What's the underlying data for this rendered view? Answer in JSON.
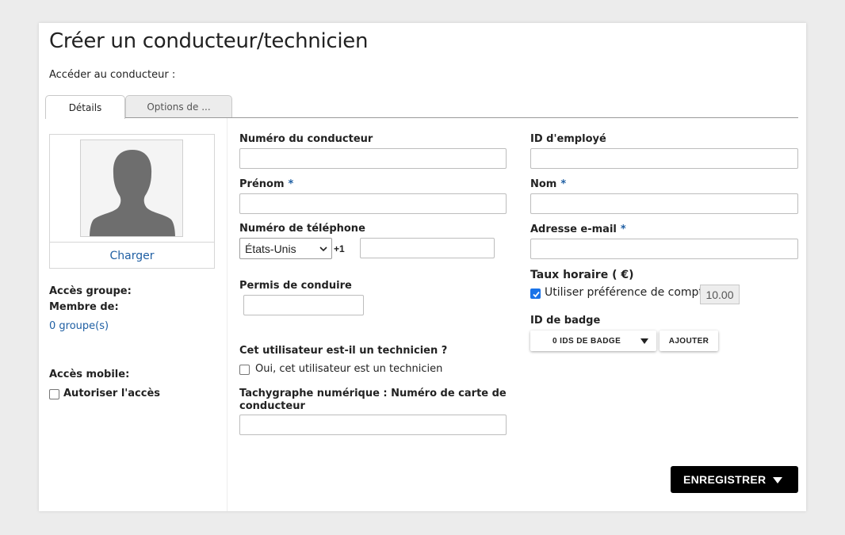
{
  "page": {
    "title": "Créer un conducteur/technicien",
    "access_label": "Accéder au conducteur :"
  },
  "tabs": [
    {
      "label": "Détails",
      "active": true
    },
    {
      "label": "Options de ...",
      "active": false
    }
  ],
  "photo": {
    "upload_label": "Charger",
    "avatar_icon": "person-silhouette-icon"
  },
  "sidebar": {
    "group_access_label": "Accès groupe:",
    "member_of_label": "Membre de:",
    "groups_link": "0 groupe(s)",
    "mobile_access_label": "Accès mobile:",
    "allow_access_label": "Autoriser l'accès",
    "allow_access_checked": false
  },
  "form": {
    "driver_number": {
      "label": "Numéro du conducteur",
      "value": "",
      "placeholder": ""
    },
    "employee_id": {
      "label": "ID d'employé",
      "value": "",
      "placeholder": ""
    },
    "first_name": {
      "label": "Prénom",
      "required_mark": "*",
      "value": "",
      "placeholder": ""
    },
    "last_name": {
      "label": "Nom",
      "required_mark": "*",
      "value": "",
      "placeholder": ""
    },
    "phone": {
      "label": "Numéro de téléphone",
      "country": "États-Unis",
      "dial_code": "+1",
      "value": "",
      "placeholder": ""
    },
    "email": {
      "label": "Adresse e-mail",
      "required_mark": "*",
      "value": "",
      "placeholder": ""
    },
    "license": {
      "label": "Permis de conduire",
      "value": "",
      "placeholder": ""
    },
    "hourly_rate": {
      "label": "Taux horaire ( €)",
      "use_account_pref_label": "Utiliser préférence de compte",
      "use_account_pref_checked": true,
      "value": "10.00"
    },
    "badge": {
      "label": "ID de badge",
      "dropdown_label": "0 IDS DE BADGE",
      "add_label": "AJOUTER"
    },
    "technician": {
      "question": "Cet utilisateur est-il un technicien ?",
      "checkbox_label": "Oui, cet utilisateur est un technicien",
      "checked": false
    },
    "tachograph": {
      "label": "Tachygraphe numérique : Numéro de carte de conducteur",
      "value": "",
      "placeholder": ""
    }
  },
  "actions": {
    "save_label": "ENREGISTRER"
  },
  "colors": {
    "link": "#1f5fa3",
    "checkbox_checked": "#1a73e8",
    "save_button": "#000000"
  }
}
